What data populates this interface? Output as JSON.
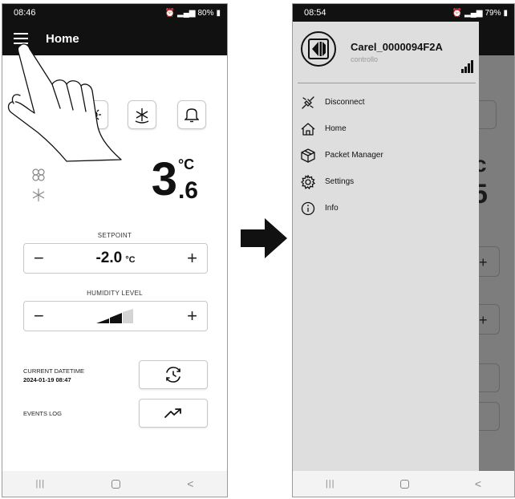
{
  "left_screen": {
    "status": {
      "time": "08:46",
      "battery": "80%"
    },
    "appbar": {
      "title": "Home"
    },
    "temperature": {
      "integer": "3",
      "decimal": ".6",
      "unit": "°C"
    },
    "setpoint": {
      "label": "SETPOINT",
      "value": "-2.0",
      "unit": "°C",
      "minus": "−",
      "plus": "+"
    },
    "humidity": {
      "label": "HUMIDITY LEVEL",
      "minus": "−",
      "plus": "+",
      "level_bars_filled": 2,
      "level_bars_total": 3
    },
    "datetime": {
      "label": "CURRENT DATETIME",
      "value": "2024-01-19 08:47"
    },
    "events": {
      "label": "EVENTS LOG"
    }
  },
  "right_screen": {
    "status": {
      "time": "08:54",
      "battery": "79%"
    },
    "drawer": {
      "device_name": "Carel_0000094F2A",
      "subtitle": "controllo",
      "items": [
        {
          "label": "Disconnect",
          "icon": "disconnect-icon"
        },
        {
          "label": "Home",
          "icon": "home-icon"
        },
        {
          "label": "Packet Manager",
          "icon": "package-icon"
        },
        {
          "label": "Settings",
          "icon": "gear-icon"
        },
        {
          "label": "Info",
          "icon": "info-icon"
        }
      ]
    },
    "background_glyphs": {
      "unit_fragment": "c",
      "digit_fragment": "5",
      "plus_1": "+",
      "plus_2": "+"
    }
  },
  "colors": {
    "appbar": "#111111",
    "drawer": "#dedede",
    "scrim": "#7d7d7d",
    "arrow": "#111111"
  }
}
